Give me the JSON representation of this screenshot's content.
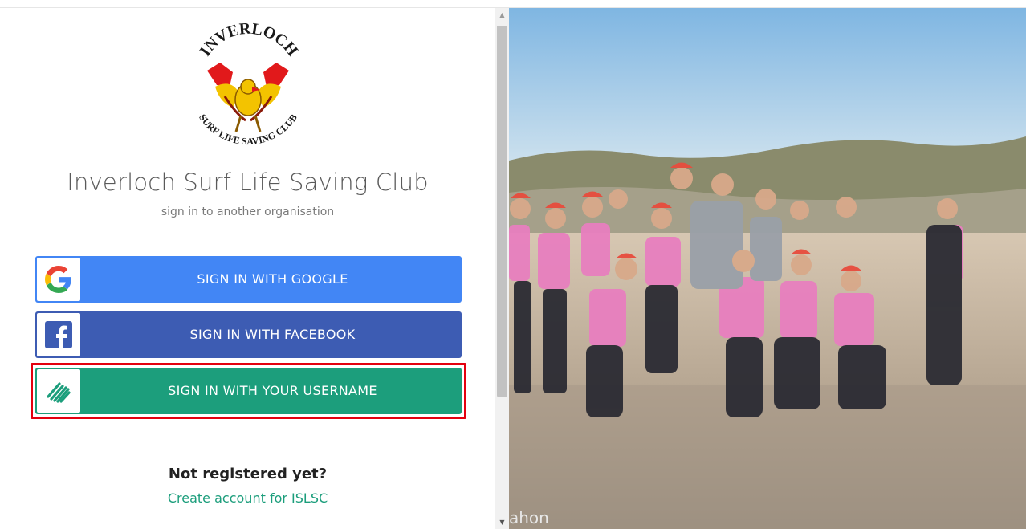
{
  "org": {
    "title": "Inverloch Surf Life Saving Club",
    "subtitle": "sign in to another organisation",
    "logo_text_top": "INVERLOCH",
    "logo_text_bottom": "SURF LIFE SAVING CLUB"
  },
  "buttons": {
    "google": {
      "label": "SIGN IN WITH GOOGLE",
      "icon": "google-g-icon",
      "color": "#4286f5"
    },
    "facebook": {
      "label": "SIGN IN WITH FACEBOOK",
      "icon": "facebook-f-icon",
      "color": "#3d5cb3"
    },
    "username": {
      "label": "SIGN IN WITH YOUR USERNAME",
      "icon": "stripes-logo-icon",
      "color": "#1c9e7c"
    }
  },
  "register": {
    "prompt": "Not registered yet?",
    "link": "Create account for ISLSC"
  },
  "photo": {
    "caption_fragment": "ahon"
  },
  "colors": {
    "highlight": "#e3000f"
  }
}
